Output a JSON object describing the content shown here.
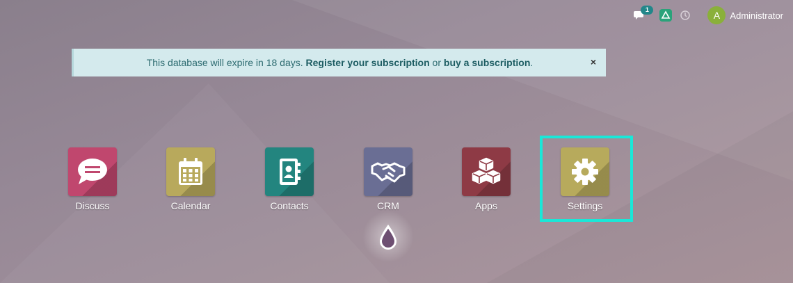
{
  "systray": {
    "messages_count": "1",
    "user_initial": "A",
    "user_name": "Administrator"
  },
  "banner": {
    "text_before": "This database will expire in 18 days. ",
    "register_link": "Register your subscription",
    "text_middle": " or ",
    "buy_link": "buy a subscription",
    "text_after": ".",
    "close_label": "×"
  },
  "apps": [
    {
      "label": "Discuss",
      "color": "#c0476e",
      "icon": "chat-bubble-icon"
    },
    {
      "label": "Calendar",
      "color": "#b8a95c",
      "icon": "calendar-icon"
    },
    {
      "label": "Contacts",
      "color": "#23857f",
      "icon": "address-book-icon"
    },
    {
      "label": "CRM",
      "color": "#6a6e94",
      "icon": "handshake-icon"
    },
    {
      "label": "Apps",
      "color": "#8e3a45",
      "icon": "cubes-icon"
    },
    {
      "label": "Settings",
      "color": "#b7aa5c",
      "icon": "gear-icon"
    }
  ],
  "colors": {
    "highlight": "#19e8d8",
    "banner_bg": "#d4eaed",
    "banner_text": "#2c6b70"
  }
}
